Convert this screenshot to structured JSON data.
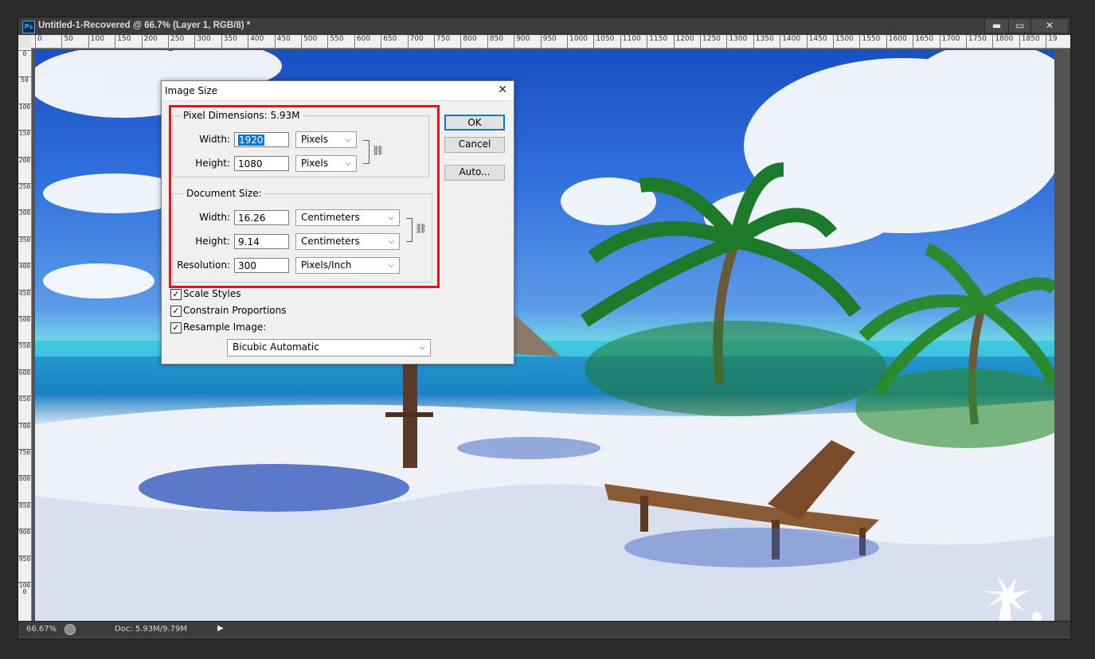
{
  "window": {
    "title": "Untitled-1-Recovered @ 66.7% (Layer 1, RGB/8) *",
    "app_icon": "Ps",
    "controls": {
      "minimize": "▬",
      "maximize": "▭",
      "close": "✕"
    }
  },
  "ruler": {
    "top_labels": [
      "0",
      "50",
      "100",
      "150",
      "200",
      "250",
      "300",
      "350",
      "400",
      "450",
      "500",
      "550",
      "600",
      "650",
      "700",
      "750",
      "800",
      "850",
      "900",
      "950",
      "1000",
      "1050",
      "1100",
      "1150",
      "1200",
      "1250",
      "1300",
      "1350",
      "1400",
      "1450",
      "1500",
      "1550",
      "1600",
      "1650",
      "1700",
      "1750",
      "1800",
      "1850",
      "19"
    ],
    "left_labels": [
      "0",
      "50",
      "100",
      "150",
      "200",
      "250",
      "300",
      "350",
      "400",
      "450",
      "500",
      "550",
      "600",
      "650",
      "700",
      "750",
      "800",
      "850",
      "900",
      "950",
      "1000"
    ]
  },
  "status": {
    "zoom": "66.67%",
    "doc": "Doc: 5.93M/9.79M",
    "arrow": "▶"
  },
  "dialog": {
    "title": "Image Size",
    "close": "✕",
    "pixel_dimensions": {
      "legend": "Pixel Dimensions:  5.93M",
      "width_label": "Width:",
      "width_value": "1920",
      "width_unit": "Pixels",
      "height_label": "Height:",
      "height_value": "1080",
      "height_unit": "Pixels"
    },
    "document_size": {
      "legend": "Document Size:",
      "width_label": "Width:",
      "width_value": "16.26",
      "width_unit": "Centimeters",
      "height_label": "Height:",
      "height_value": "9.14",
      "height_unit": "Centimeters",
      "resolution_label": "Resolution:",
      "resolution_value": "300",
      "resolution_unit": "Pixels/Inch"
    },
    "options": {
      "scale_styles": "Scale Styles",
      "constrain": "Constrain Proportions",
      "resample": "Resample Image:",
      "resample_method": "Bicubic Automatic",
      "check_mark": "✓"
    },
    "buttons": {
      "ok": "OK",
      "cancel": "Cancel",
      "auto": "Auto..."
    },
    "chevron": "⌵",
    "chain_glyph": "⛓"
  },
  "colors": {
    "highlight_box": "#e3141a",
    "default_button_border": "#0078d7"
  }
}
